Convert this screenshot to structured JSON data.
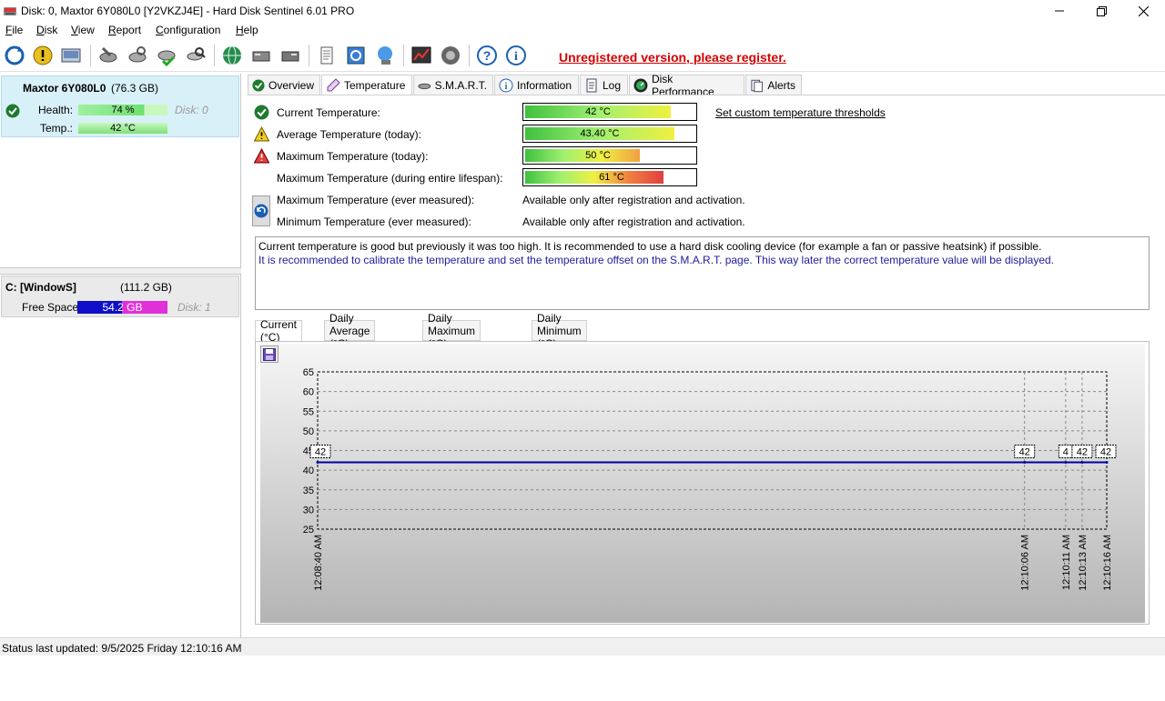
{
  "window": {
    "title": "Disk: 0, Maxtor 6Y080L0 [Y2VKZJ4E]  -  Hard Disk Sentinel 6.01 PRO"
  },
  "menu": [
    {
      "label": "File",
      "u": "F",
      "rest": "ile"
    },
    {
      "label": "Disk",
      "u": "D",
      "rest": "isk"
    },
    {
      "label": "View",
      "u": "V",
      "rest": "iew"
    },
    {
      "label": "Report",
      "u": "R",
      "rest": "eport"
    },
    {
      "label": "Configuration",
      "u": "C",
      "rest": "onfiguration"
    },
    {
      "label": "Help",
      "u": "H",
      "rest": "elp"
    }
  ],
  "toolbar": {
    "register_text": "Unregistered version, please register."
  },
  "disk": {
    "name": "Maxtor 6Y080L0",
    "size": "(76.3 GB)",
    "health_label": "Health:",
    "health_value": "74 %",
    "health_pct": 74,
    "disk_label": "Disk: 0",
    "temp_label": "Temp.:",
    "temp_value": "42 °C"
  },
  "volume": {
    "name": "C: [WindowS]",
    "size": "(111.2 GB)",
    "free_label": "Free Space",
    "free_value": "54.2 GB",
    "free_fraction": 0.49,
    "disk_label": "Disk: 1"
  },
  "tabs": [
    {
      "label": "Overview",
      "icon": "check-icon"
    },
    {
      "label": "Temperature",
      "icon": "thermometer-icon",
      "active": true
    },
    {
      "label": "S.M.A.R.T.",
      "icon": "drive-icon"
    },
    {
      "label": "Information",
      "icon": "info-icon"
    },
    {
      "label": "Log",
      "icon": "log-icon"
    },
    {
      "label": "Disk Performance",
      "icon": "gauge-icon"
    },
    {
      "label": "Alerts",
      "icon": "alerts-icon"
    }
  ],
  "temperature": {
    "current_label": "Current Temperature:",
    "current_value": "42 °C",
    "avg_label": "Average Temperature (today):",
    "avg_value": "43.40 °C",
    "max_today_label": "Maximum Temperature (today):",
    "max_today_value": "50 °C",
    "max_life_label": "Maximum Temperature (during entire lifespan):",
    "max_life_value": "61 °C",
    "max_ever_label": "Maximum Temperature (ever measured):",
    "min_ever_label": "Minimum Temperature (ever measured):",
    "avail_text": "Available only after registration and activation.",
    "threshold_link": "Set custom temperature thresholds"
  },
  "message": {
    "line1": "Current temperature is good but previously it was too high. It is recommended to use a hard disk cooling device (for example a fan or passive heatsink) if possible.",
    "line2": "It is recommended to calibrate the temperature and set the temperature offset on the S.M.A.R.T. page. This way later the correct temperature value will be displayed."
  },
  "chart_tabs": [
    "Current (°C)",
    "Daily Average (°C)",
    "Daily Maximum (°C)",
    "Daily Minimum (°C)"
  ],
  "chart_data": {
    "type": "line",
    "x": [
      "12:08:40 AM",
      "12:10:06 AM",
      "12:10:11 AM",
      "12:10:13 AM",
      "12:10:16 AM"
    ],
    "x_seconds": [
      0,
      86,
      91,
      93,
      96
    ],
    "series": [
      {
        "values": [
          42,
          42,
          42,
          42,
          42
        ]
      }
    ],
    "point_labels": [
      "42",
      "42",
      "4",
      "42",
      "42"
    ],
    "ylim": [
      25,
      65
    ],
    "yticks": [
      25,
      30,
      35,
      40,
      45,
      50,
      55,
      60,
      65
    ],
    "grid": true,
    "line_color": "#0000a0"
  },
  "status": {
    "text": "Status last updated: 9/5/2025 Friday 12:10:16 AM"
  }
}
